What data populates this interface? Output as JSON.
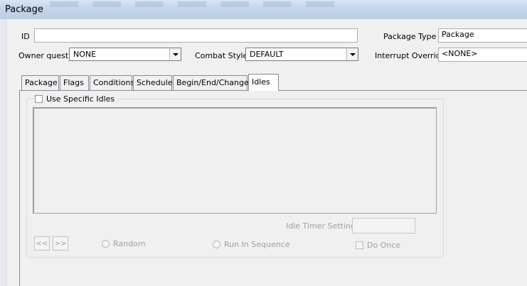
{
  "window": {
    "title": "Package"
  },
  "form": {
    "id_label": "ID",
    "id_value": "",
    "package_type_label": "Package Type",
    "package_type_value": "Package",
    "owner_quest_label": "Owner quest",
    "owner_quest_value": "NONE",
    "combat_style_label": "Combat Style",
    "combat_style_value": "DEFAULT",
    "interrupt_override_label": "Interrupt Override",
    "interrupt_override_value": "<NONE>"
  },
  "tabs": [
    {
      "label": "Package"
    },
    {
      "label": "Flags"
    },
    {
      "label": "Conditions"
    },
    {
      "label": "Schedule"
    },
    {
      "label": "Begin/End/Change"
    },
    {
      "label": "Idles"
    }
  ],
  "idles": {
    "use_specific_idles_label": "Use Specific Idles",
    "use_specific_idles_checked": false,
    "idle_timer_label": "Idle Timer Setting",
    "idle_timer_value": "",
    "prev_label": "<<",
    "next_label": ">>",
    "random_label": "Random",
    "run_in_sequence_label": "Run In Sequence",
    "do_once_label": "Do Once"
  }
}
